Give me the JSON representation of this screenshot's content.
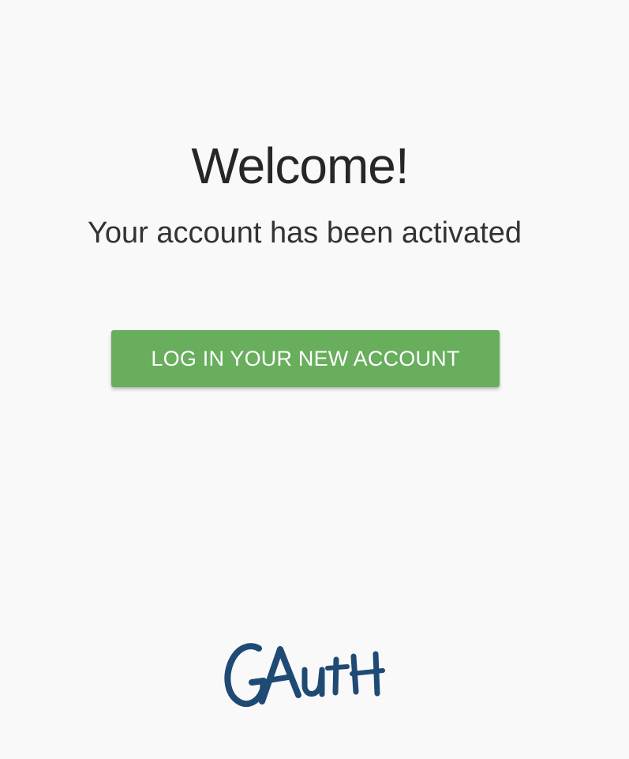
{
  "welcome": {
    "title": "Welcome!",
    "subtitle": "Your account has been activated"
  },
  "actions": {
    "login_label": "LOG IN YOUR NEW ACCOUNT"
  },
  "brand": {
    "logo_text": "GAuth",
    "logo_color": "#1f4a74"
  },
  "colors": {
    "background": "#f9f9f9",
    "button": "#68ae5d",
    "button_text": "#ffffff"
  }
}
